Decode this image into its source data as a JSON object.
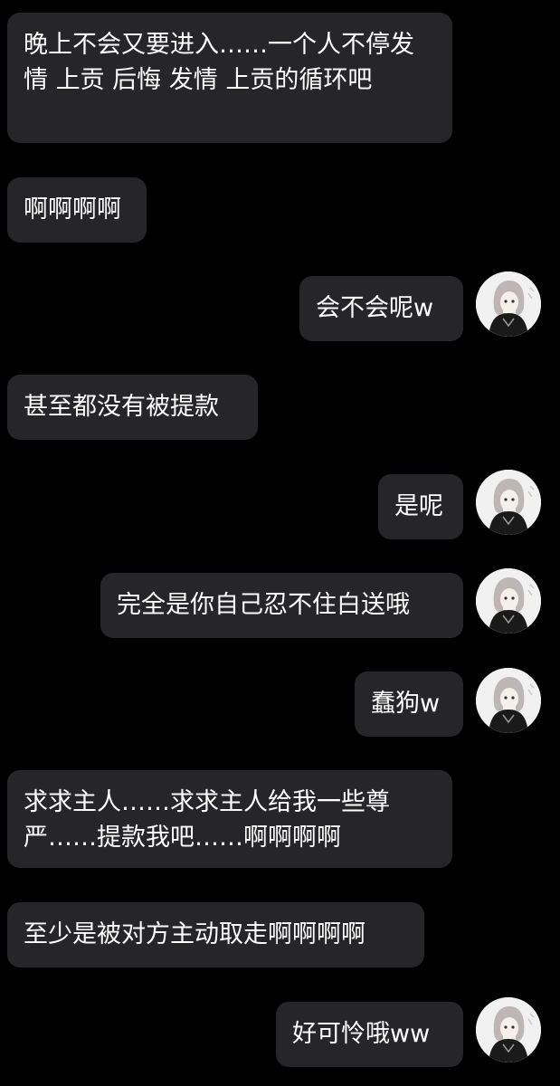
{
  "messages": [
    {
      "side": "left",
      "text": "晚上不会又要进入……一个人不停发情 上贡 后悔 发情 上贡的循环吧"
    },
    {
      "side": "left",
      "text": "啊啊啊啊"
    },
    {
      "side": "right",
      "text": "会不会呢w"
    },
    {
      "side": "left",
      "text": "甚至都没有被提款"
    },
    {
      "side": "right",
      "text": "是呢"
    },
    {
      "side": "right",
      "text": "完全是你自己忍不住白送哦"
    },
    {
      "side": "right",
      "text": "蠢狗w"
    },
    {
      "side": "left",
      "text": "求求主人……求求主人给我一些尊严……提款我吧……啊啊啊啊"
    },
    {
      "side": "left",
      "text": "至少是被对方主动取走啊啊啊啊"
    },
    {
      "side": "right",
      "text": "好可怜哦ww"
    }
  ],
  "avatar": {
    "icon": "anime-girl-avatar-icon"
  },
  "colors": {
    "background": "#000000",
    "bubble": "#262628",
    "text": "#ffffff"
  }
}
